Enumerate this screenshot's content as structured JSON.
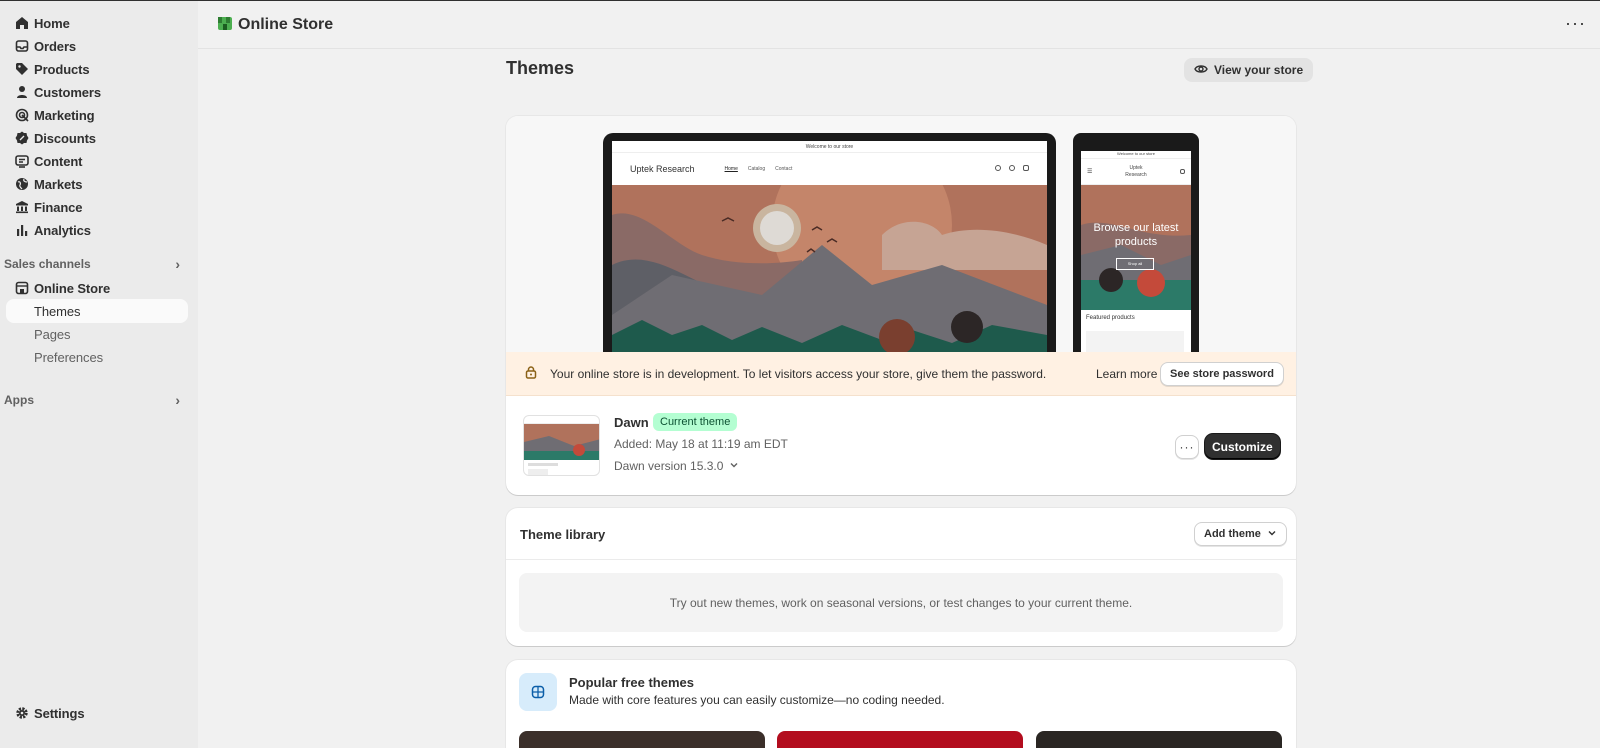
{
  "sidebar": {
    "items": [
      {
        "label": "Home",
        "icon": "home-icon"
      },
      {
        "label": "Orders",
        "icon": "inbox-icon"
      },
      {
        "label": "Products",
        "icon": "tag-icon"
      },
      {
        "label": "Customers",
        "icon": "person-icon"
      },
      {
        "label": "Marketing",
        "icon": "target-icon"
      },
      {
        "label": "Discounts",
        "icon": "discount-icon"
      },
      {
        "label": "Content",
        "icon": "content-icon"
      },
      {
        "label": "Markets",
        "icon": "globe-icon"
      },
      {
        "label": "Finance",
        "icon": "bank-icon"
      },
      {
        "label": "Analytics",
        "icon": "bar-chart-icon"
      }
    ],
    "sales_channels_label": "Sales channels",
    "online_store_label": "Online Store",
    "sub_items": [
      {
        "label": "Themes",
        "active": true
      },
      {
        "label": "Pages",
        "active": false
      },
      {
        "label": "Preferences",
        "active": false
      }
    ],
    "apps_label": "Apps",
    "settings_label": "Settings"
  },
  "topbar": {
    "title": "Online Store",
    "more": "···"
  },
  "main": {
    "title": "Themes",
    "view_store_label": "View your store",
    "preview": {
      "announcement": "Welcome to our store",
      "brand": "Uptek Research",
      "links": [
        "Home",
        "Catalog",
        "Contact"
      ],
      "phone_announcement": "Welcome to our store",
      "phone_brand": "Uptek Research",
      "phone_hero": "Browse our latest products",
      "phone_button": "Shop all",
      "phone_featured": "Featured products"
    },
    "banner": {
      "message": "Your online store is in development. To let visitors access your store, give them the password.",
      "learn_more": "Learn more",
      "see_password": "See store password"
    },
    "current_theme": {
      "name": "Dawn",
      "badge": "Current theme",
      "added": "Added: May 18 at 11:19 am EDT",
      "version": "Dawn version 15.3.0",
      "more_label": "···",
      "customize_label": "Customize"
    },
    "library": {
      "title": "Theme library",
      "add_theme_label": "Add theme",
      "empty_text": "Try out new themes, work on seasonal versions, or test changes to your current theme."
    },
    "popular": {
      "title": "Popular free themes",
      "subtitle": "Made with core features you can easily customize—no coding needed."
    }
  },
  "colors": {
    "accent_dark": "#303030",
    "badge_bg": "#b4fed2",
    "banner_bg": "#fff1e3",
    "store_green": "#4caf50"
  }
}
